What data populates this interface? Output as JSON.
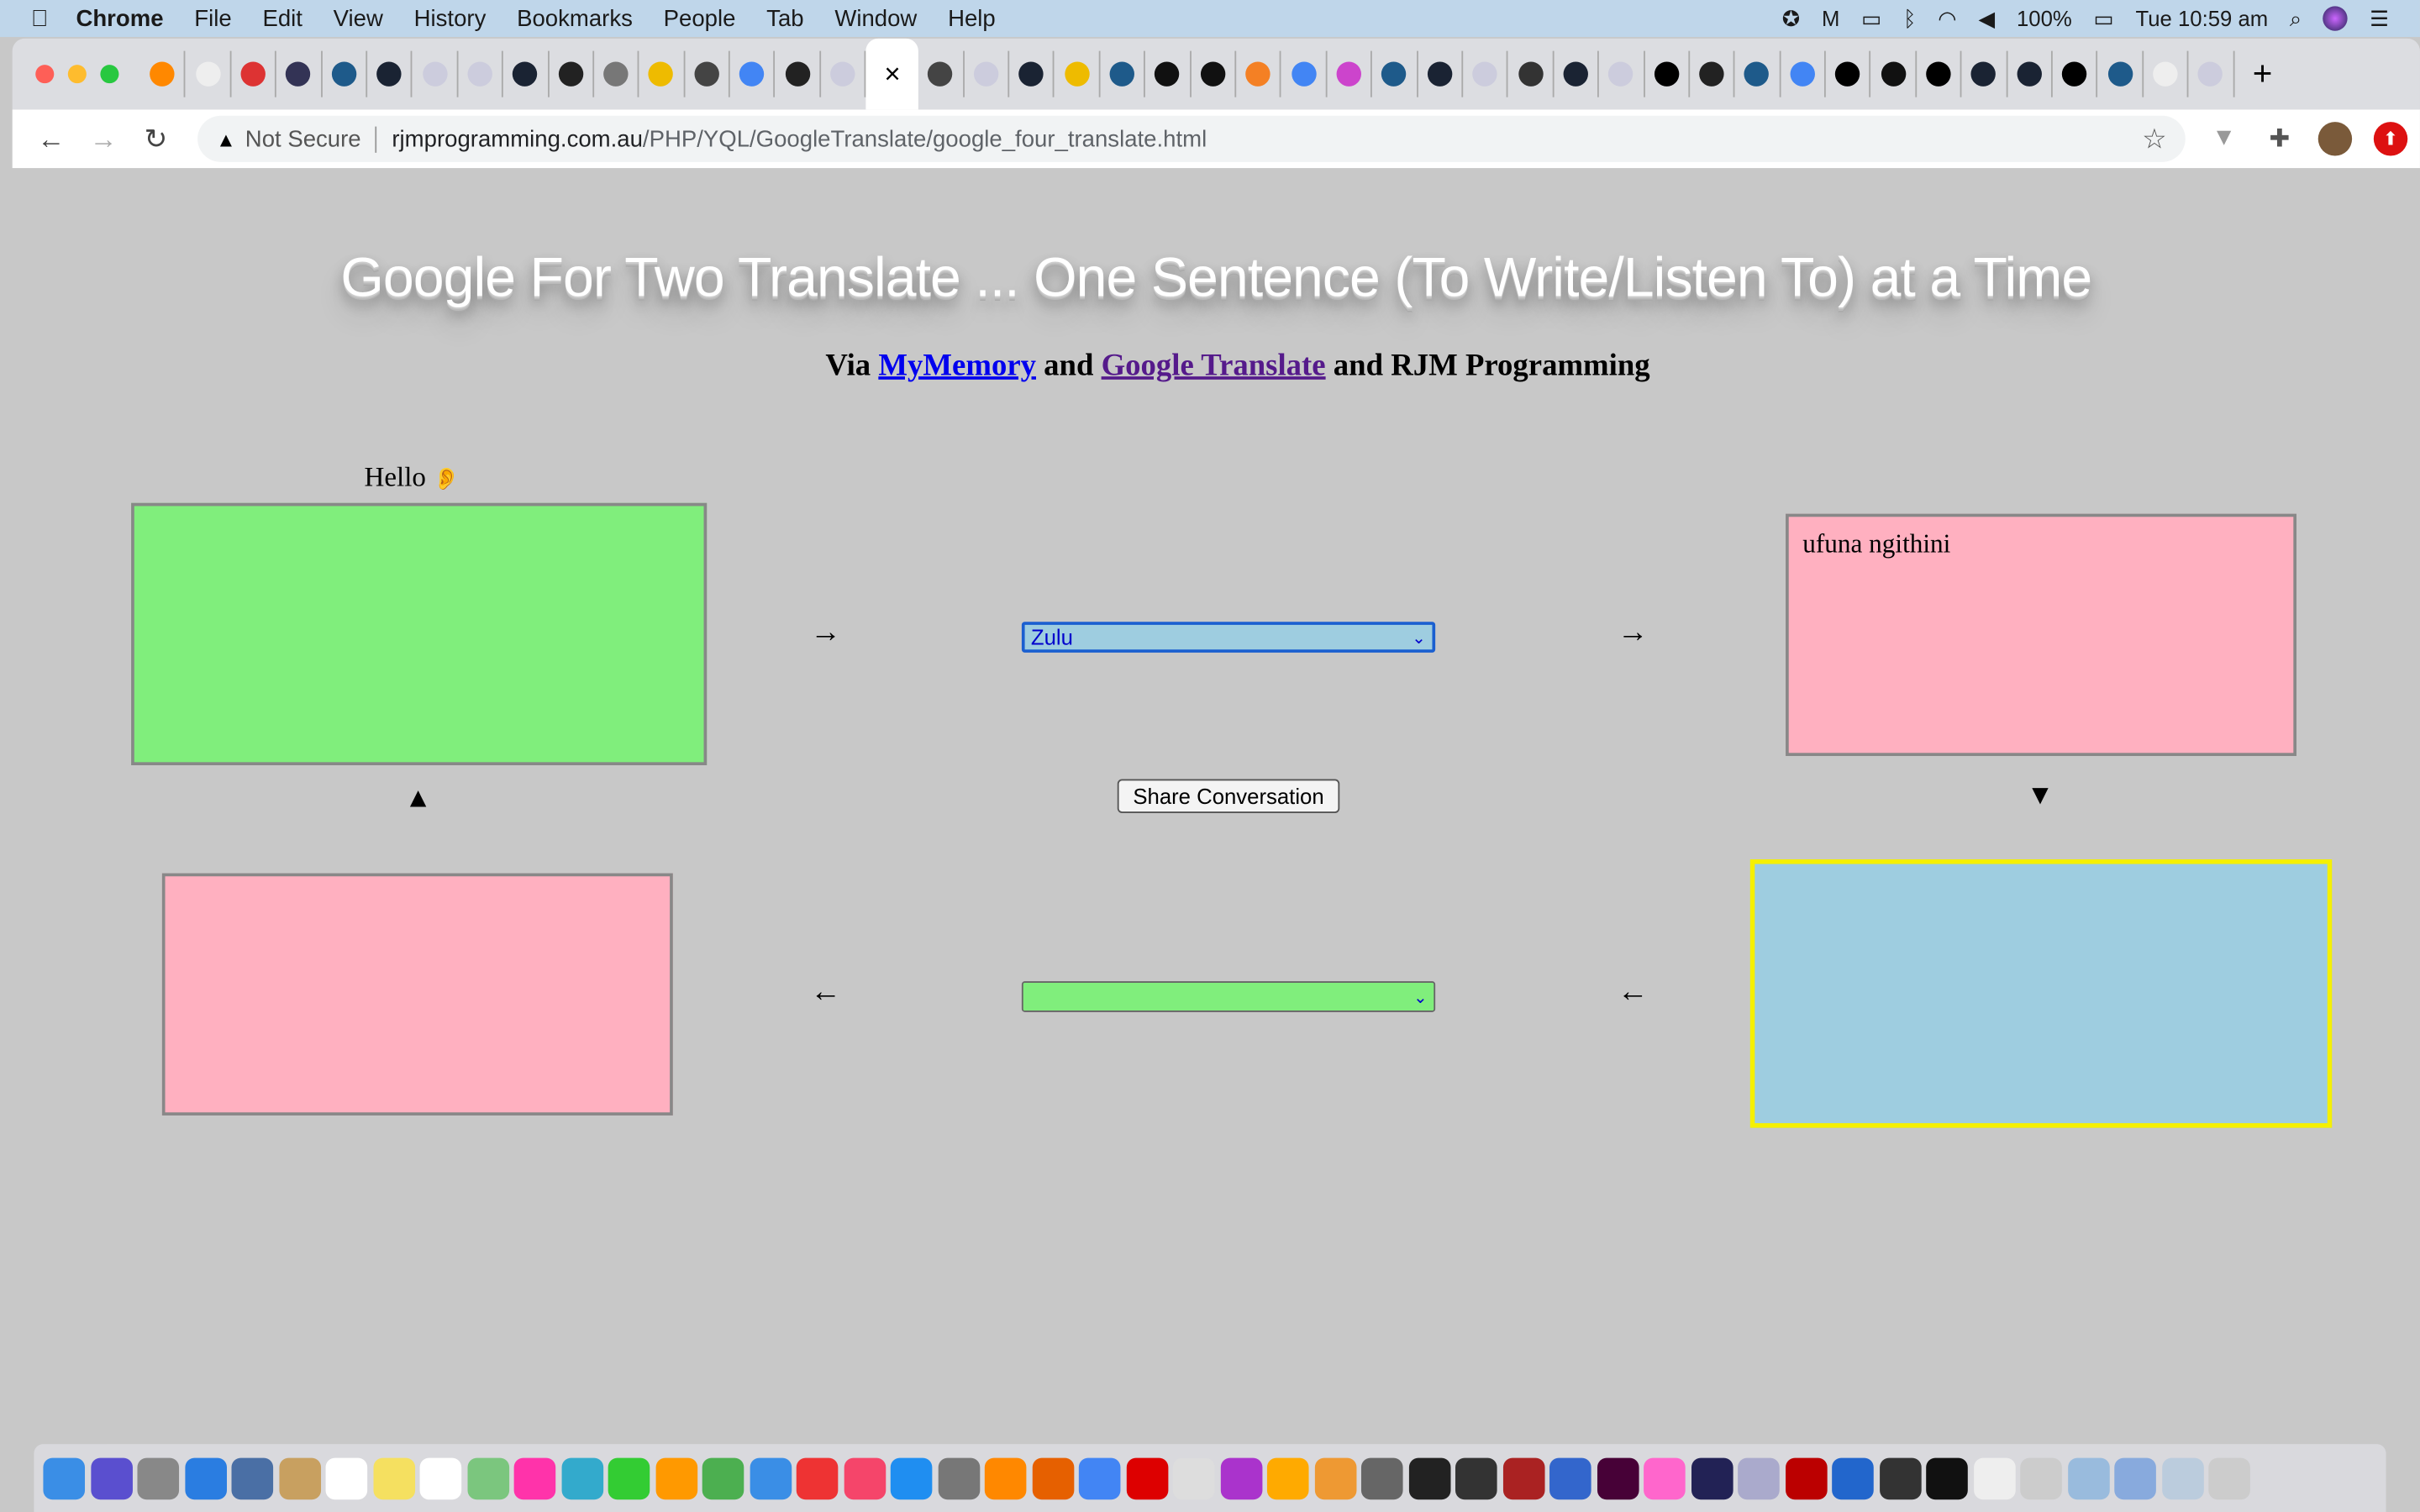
{
  "menubar": {
    "app": "Chrome",
    "items": [
      "File",
      "Edit",
      "View",
      "History",
      "Bookmarks",
      "People",
      "Tab",
      "Window",
      "Help"
    ],
    "battery": "100%",
    "clock": "Tue 10:59 am"
  },
  "tabs": {
    "favicons": [
      "cp",
      "pma",
      "gmail",
      "w",
      "blue-dot",
      "amazon",
      "chart",
      "chart",
      "amazon",
      "braces",
      "github",
      "check",
      "globe",
      "translate",
      "braces",
      "chart",
      "close",
      "globe",
      "chart",
      "amazon",
      "check",
      "blue-dot",
      "s",
      "s",
      "stack",
      "translate",
      "nbc",
      "blue-dot",
      "amazon",
      "chart",
      "slash",
      "amazon",
      "chart",
      "abc",
      "braces",
      "blue-dot",
      "google",
      "abc",
      "s",
      "abc",
      "amazon",
      "amazon",
      "abc",
      "blue-dot",
      "pma",
      "chart"
    ],
    "active_index": 16,
    "close_glyph": "×",
    "new_tab": "+"
  },
  "toolbar": {
    "security": "Not Secure",
    "host": "rjmprogramming.com.au",
    "path": "/PHP/YQL/GoogleTranslate/google_four_translate.html"
  },
  "page": {
    "title": "Google For Two Translate ... One Sentence (To Write/Listen To) at a Time",
    "sub_via": "Via",
    "link1": "MyMemory",
    "sub_and1": "and",
    "link2": "Google Translate",
    "sub_and2": "and RJM Programming",
    "hello": "Hello",
    "ear": "👂",
    "top_right_text": "ufuna ngithini",
    "lang_top": "Zulu",
    "lang_bottom": "",
    "share": "Share Conversation",
    "arrow_right": "→",
    "arrow_left": "←",
    "up": "▲",
    "down": "▼"
  },
  "colors": {
    "green": "#80ee7c",
    "pink": "#ffb0c0",
    "blue": "#9ecde0",
    "yellow": "#f5f000",
    "page_bg": "#c8c8c8"
  },
  "dock": [
    "finder",
    "siri",
    "launchpad",
    "safari",
    "preview",
    "notes",
    "calendar",
    "stickies",
    "reminders",
    "maps",
    "photos",
    "messages",
    "facetime",
    "pages",
    "numbers",
    "keynote",
    "news",
    "music",
    "appstore",
    "settings",
    "amazon",
    "firefox",
    "chrome",
    "opera",
    "gimp",
    "phpstorm",
    "filezilla-like",
    "app",
    "app",
    "terminal",
    "inkscape",
    "app",
    "r",
    "xd",
    "app",
    "app",
    "app",
    "filezilla",
    "audacity",
    "f",
    "terminal2",
    "textedit",
    "app",
    "finder-folder",
    "downloads",
    "docs",
    "trash"
  ]
}
